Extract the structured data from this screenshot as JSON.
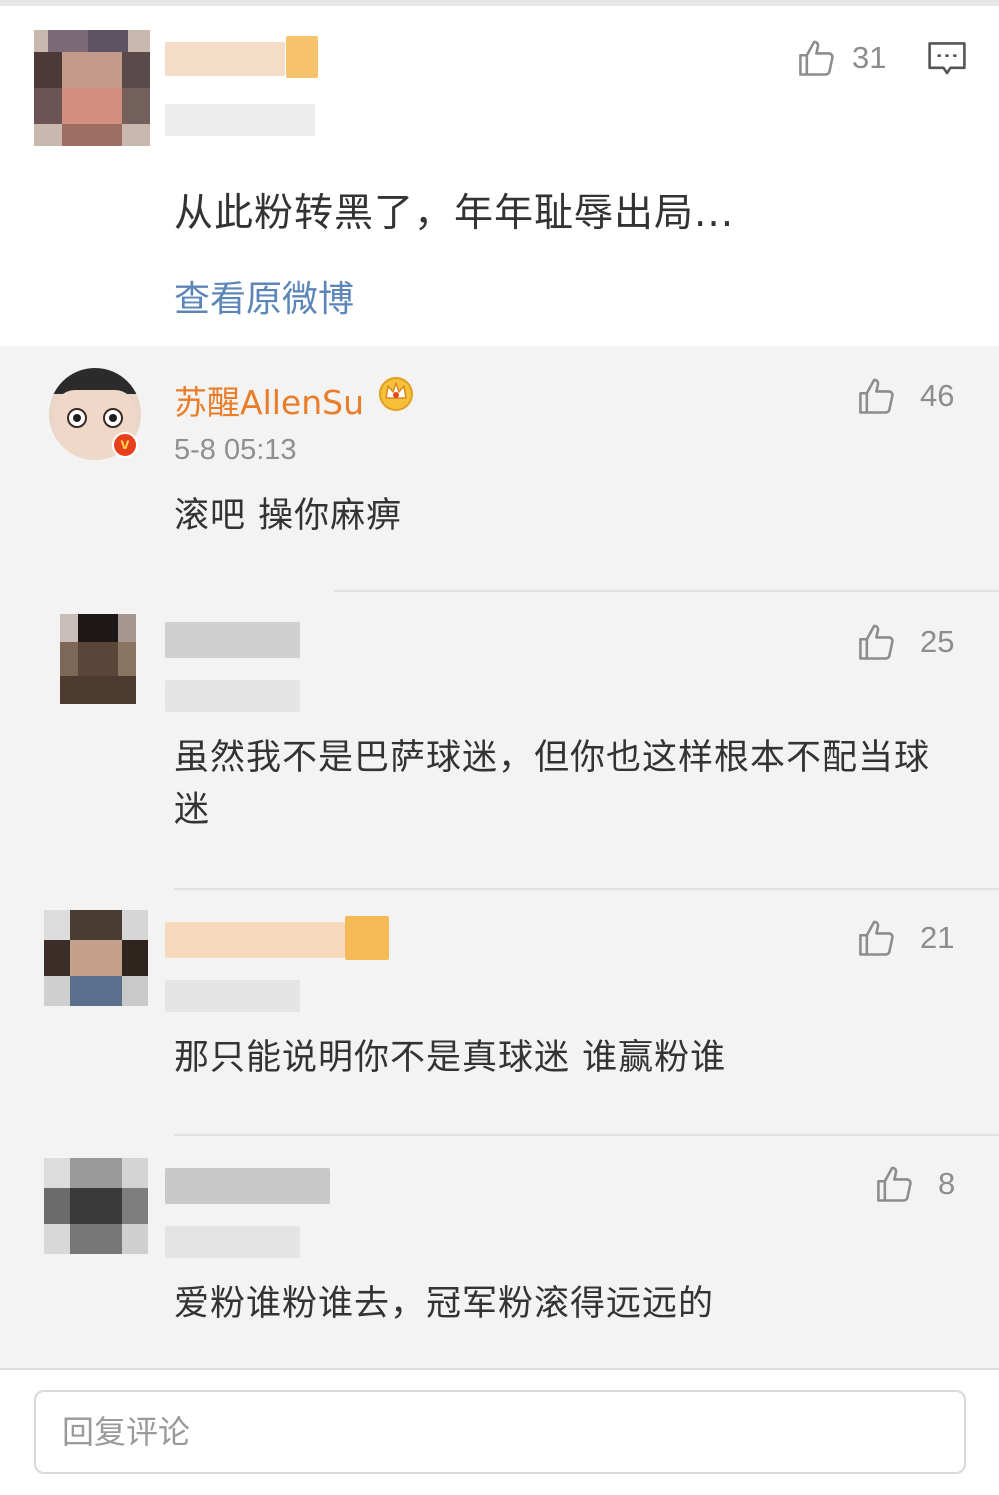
{
  "post": {
    "text": "从此粉转黑了，年年耻辱出局...",
    "view_original": "查看原微博",
    "like_count": "31"
  },
  "replies": [
    {
      "username": "苏醒AllenSu",
      "timestamp": "5-8 05:13",
      "text": "滚吧 操你麻痹",
      "likes": "46"
    },
    {
      "text": "虽然我不是巴萨球迷，但你也这样根本不配当球迷",
      "likes": "25"
    },
    {
      "text": "那只能说明你不是真球迷 谁赢粉谁",
      "likes": "21"
    },
    {
      "text": "爱粉谁粉谁去，冠军粉滚得远远的",
      "likes": "8"
    }
  ],
  "input": {
    "placeholder": "回复评论"
  },
  "colors": {
    "username": "#e97d2a",
    "link": "#5d86b8",
    "verified_badge": "#e8401c",
    "vip_crown": "#f2a623"
  }
}
